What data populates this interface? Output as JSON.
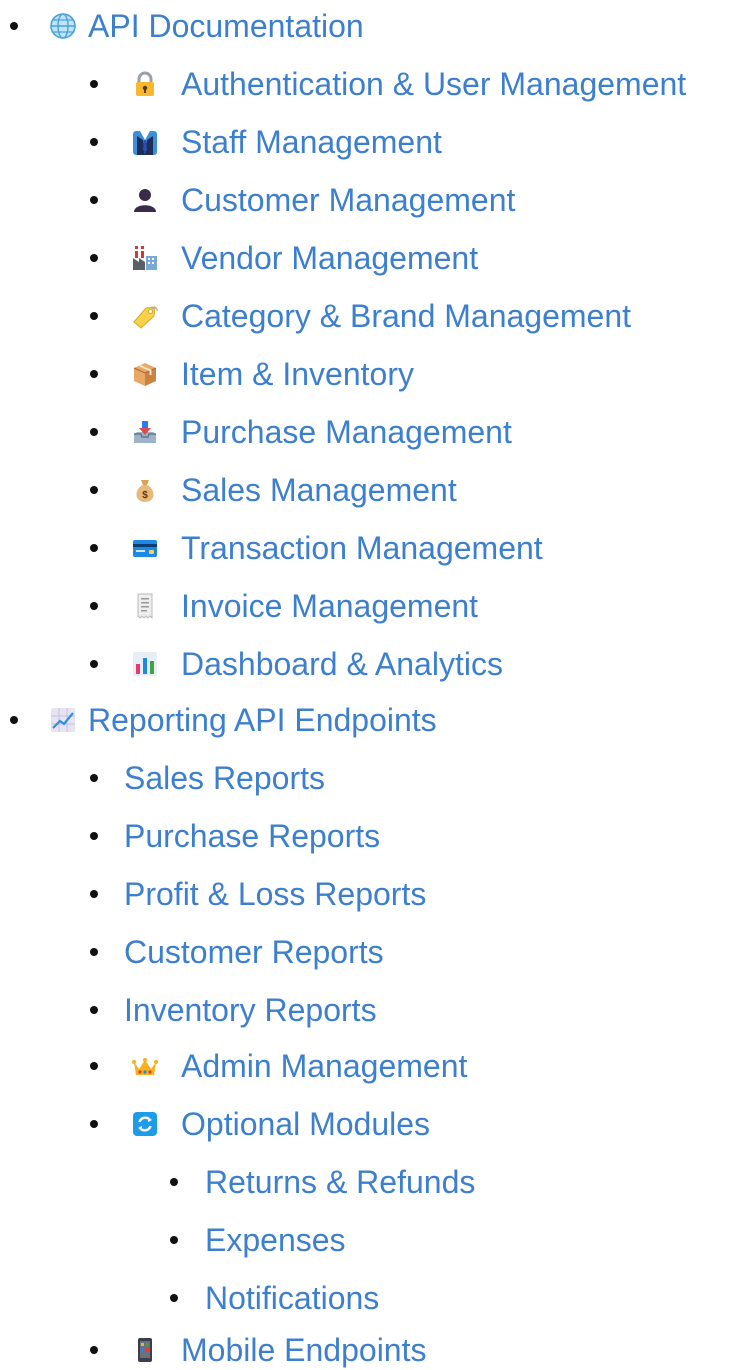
{
  "toc": {
    "api_documentation": {
      "label": "API Documentation",
      "icon": "globe-icon",
      "children": [
        {
          "label": "Authentication & User Management",
          "icon": "lock-key-icon"
        },
        {
          "label": "Staff Management",
          "icon": "suit-person-icon"
        },
        {
          "label": "Customer Management",
          "icon": "person-silhouette-icon"
        },
        {
          "label": "Vendor Management",
          "icon": "factory-icon"
        },
        {
          "label": "Category & Brand Management",
          "icon": "tag-icon"
        },
        {
          "label": "Item & Inventory",
          "icon": "package-icon"
        },
        {
          "label": "Purchase Management",
          "icon": "inbox-tray-icon"
        },
        {
          "label": "Sales Management",
          "icon": "money-bag-icon"
        },
        {
          "label": "Transaction Management",
          "icon": "credit-card-icon"
        },
        {
          "label": "Invoice Management",
          "icon": "receipt-icon"
        },
        {
          "label": "Dashboard & Analytics",
          "icon": "bar-chart-icon"
        }
      ]
    },
    "reporting": {
      "label": "Reporting API Endpoints",
      "icon": "chart-increasing-icon",
      "children": [
        {
          "label": "Sales Reports"
        },
        {
          "label": "Purchase Reports"
        },
        {
          "label": "Profit & Loss Reports"
        },
        {
          "label": "Customer Reports"
        },
        {
          "label": "Inventory Reports"
        },
        {
          "label": "Admin Management",
          "icon": "crown-icon"
        },
        {
          "label": "Optional Modules",
          "icon": "refresh-icon",
          "children": [
            {
              "label": "Returns & Refunds"
            },
            {
              "label": "Expenses"
            },
            {
              "label": "Notifications"
            }
          ]
        },
        {
          "label": "Mobile Endpoints",
          "icon": "mobile-phone-icon"
        }
      ]
    }
  },
  "colors": {
    "link": "#3d7fcf",
    "bullet": "#111111",
    "background": "#ffffff"
  }
}
